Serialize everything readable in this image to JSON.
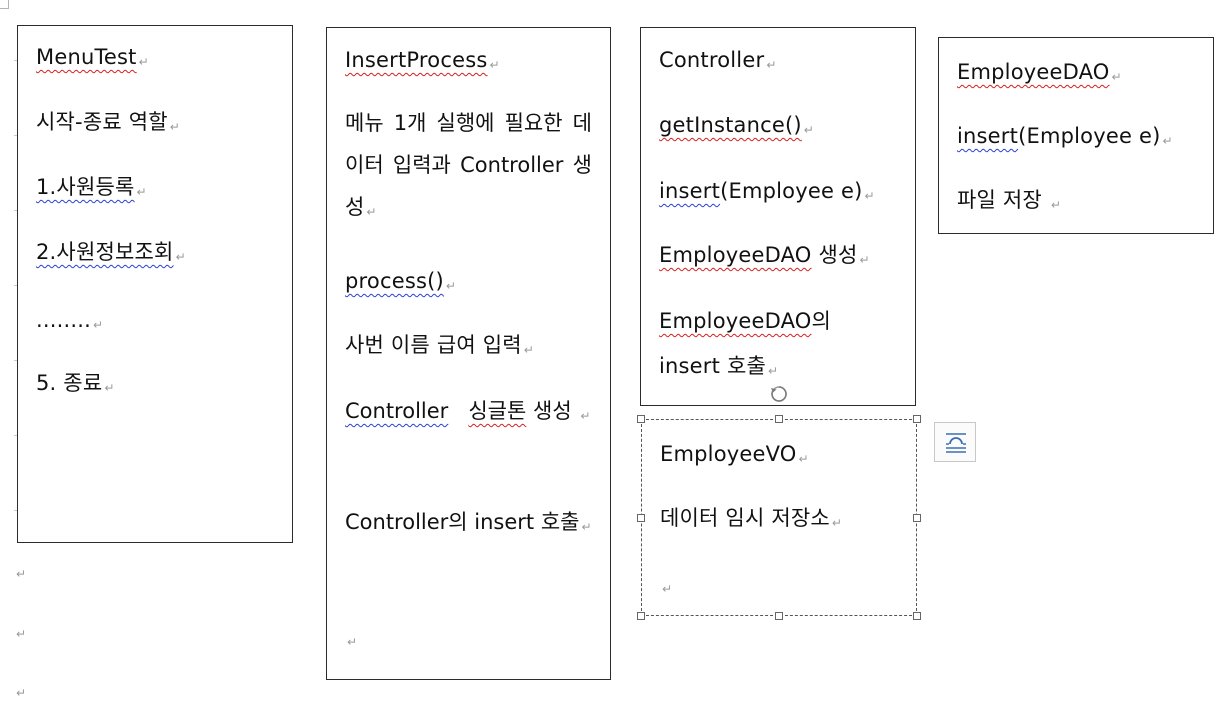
{
  "menu_box": {
    "title": "MenuTest",
    "role": "시작-종료 역할",
    "item1": "1.사원등록",
    "item2": "2.사원정보조회",
    "ellipsis": "........",
    "item5": "5. 종료"
  },
  "insert_box": {
    "title": "InsertProcess",
    "desc": "메뉴 1개 실행에 필요한 데이터 입력과 Controller 생성",
    "process": "process()",
    "input": "사번 이름 급여 입력",
    "singleton_a": "Controller",
    "singleton_b": "싱글톤",
    "singleton_c": "생성",
    "call": "Controller의 insert 호출"
  },
  "controller_box": {
    "title": "Controller",
    "get_instance": "getInstance()",
    "insert_a": "insert",
    "insert_b": "(Employee e)",
    "dao_create_a": "EmployeeDAO",
    "dao_create_b": "생성",
    "dao_of_a": "EmployeeDAO",
    "dao_of_b": "의",
    "call": "insert 호출"
  },
  "dao_box": {
    "title": "EmployeeDAO",
    "insert_a": "insert",
    "insert_b": "(Employee e)",
    "save": "파일 저장"
  },
  "vo_box": {
    "title": "EmployeeVO",
    "desc": "데이터 임시 저장소"
  },
  "icons": {
    "paragraph_mark": "↵",
    "rotate": "rotate-handle-icon",
    "layout_options": "layout-options-icon"
  },
  "colors": {
    "spell_error": "#d32020",
    "grammar_error": "#2a3fd0",
    "border": "#2b2b2b"
  }
}
